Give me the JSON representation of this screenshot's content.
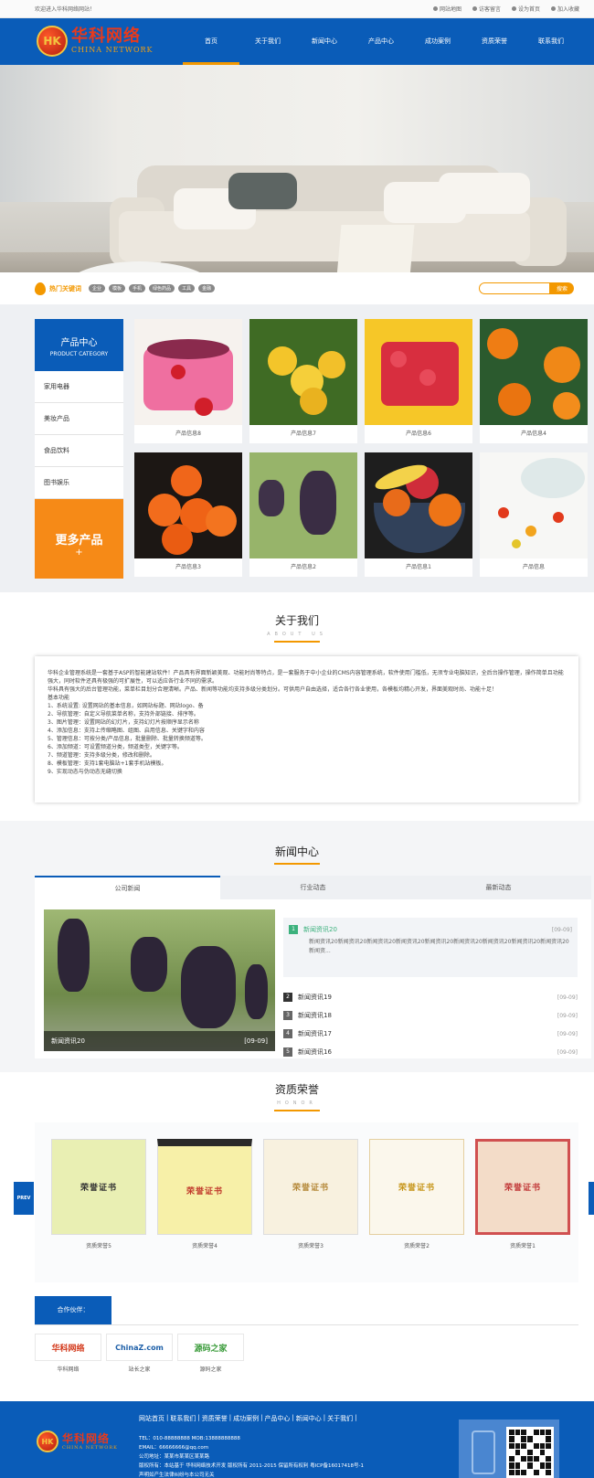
{
  "topbar": {
    "welcome": "欢迎进入华科网络网站！",
    "links": [
      "网站地图",
      "访客留言",
      "设为首页",
      "加入收藏"
    ]
  },
  "logo": {
    "badge": "HK",
    "cn": "华科网络",
    "en": "CHINA NETWORK"
  },
  "nav": [
    "首页",
    "关于我们",
    "新闻中心",
    "产品中心",
    "成功案例",
    "资质荣誉",
    "联系我们"
  ],
  "keywords": {
    "title": "热门关键词",
    "tags": [
      "企业",
      "模板",
      "手机",
      "绿色药品",
      "工具",
      "金融"
    ],
    "search_placeholder": "",
    "search_button": "搜索"
  },
  "products": {
    "side_cn": "产品中心",
    "side_en": "PRODUCT CATEGORY",
    "categories": [
      "家用电器",
      "美妆产品",
      "食品饮料",
      "图书娱乐"
    ],
    "more": "更多产品",
    "more_plus": "+",
    "items": [
      "产品信息8",
      "产品信息7",
      "产品信息6",
      "产品信息4",
      "产品信息3",
      "产品信息2",
      "产品信息1",
      "产品信息"
    ]
  },
  "about": {
    "title": "关于我们",
    "en": "ABOUT US",
    "text": "华科企业管理系统是一套基于ASP的智能建站软件！产品具有界面新颖美观、功能时尚等特点，是一套服务于中小企业的CMS内容管理系统，软件使用门槛低，无须专业电脑知识，全后台操作管理，操作简单且功能强大，同时软件还具有极强的可扩展性，可以适应各行业不同的需求。\n华科具有强大的后台管理功能，菜单栏目划分合理清晰。产品、新闻等功能均支持多级分类划分。可供用户自由选择，适合各行各业使用，各模板均精心开发，界面美观时尚、功能十足！\n基本功能\n1、系统设置: 设置网站的基本信息，如网站标题、网站logo、备\n2、导航管理：自定义导航菜单名称，支持外部链接、排序等。\n3、图片管理：设置网站的幻灯片，支持幻灯片按顺序显示名称\n4、添加信息：支持上传缩略图、组图、启用信息、关键字和内容\n5、管理信息：可按分类/产品信息，批量删除、批量转换频道等。\n6、添加频道：可设置频道分类，频道类型，关键字等。\n7、频道管理：支持多级分类，修改和删除。\n8、模板管理：支持1套电脑站+1套手机站模板。\n9、实现动态与伪动态无缝切换"
  },
  "news": {
    "title": "新闻中心",
    "tabs": [
      "公司新闻",
      "行业动态",
      "最新动态"
    ],
    "feature_title": "新闻资讯20",
    "feature_date": "[09-09]",
    "first": {
      "num": "1",
      "title": "新闻资讯20",
      "date": "[09-09]",
      "summary": "新闻资讯20新闻资讯20新闻资讯20新闻资讯20新闻资讯20新闻资讯20新闻资讯20新闻资讯20新闻资讯20新闻资..."
    },
    "list": [
      {
        "num": "2",
        "title": "新闻资讯19",
        "date": "[09-09]"
      },
      {
        "num": "3",
        "title": "新闻资讯18",
        "date": "[09-09]"
      },
      {
        "num": "4",
        "title": "新闻资讯17",
        "date": "[09-09]"
      },
      {
        "num": "5",
        "title": "新闻资讯16",
        "date": "[09-09]"
      }
    ]
  },
  "honor": {
    "title": "资质荣誉",
    "en": "HONOR",
    "prev": "PREV",
    "certs": [
      {
        "cap": "资质荣誉5",
        "t": "荣誉证书"
      },
      {
        "cap": "资质荣誉4",
        "t": "荣誉证书"
      },
      {
        "cap": "资质荣誉3",
        "t": "荣誉证书"
      },
      {
        "cap": "资质荣誉2",
        "t": "荣誉证书"
      },
      {
        "cap": "资质荣誉1",
        "t": "荣誉证书"
      }
    ]
  },
  "partners": {
    "title": "合作伙伴：",
    "items": [
      {
        "logo": "华科网络",
        "cap": "华科网络"
      },
      {
        "logo": "ChinaZ.com",
        "cap": "站长之家"
      },
      {
        "logo": "源码之家",
        "cap": "源码之家"
      }
    ]
  },
  "footer": {
    "nav": [
      "网站首页",
      "联系我们",
      "资质荣誉",
      "成功案例",
      "产品中心",
      "新闻中心",
      "关于我们"
    ],
    "tel": "TEL：010-88888888 MOB:13888888888",
    "email": "EMAIL：66666666@qq.com",
    "address": "公司地址：某某市某某区某某路",
    "copyright": "版权所有：本站基于 华科网络技术开发 版权所有 2011-2015 保留所有权利 粤ICP备16017418号-1",
    "statement": "声明如产生法律纠纷与本公司无关"
  },
  "colors": {
    "primary": "#0a5cb8",
    "accent": "#f39800",
    "green": "#3cb17d"
  }
}
